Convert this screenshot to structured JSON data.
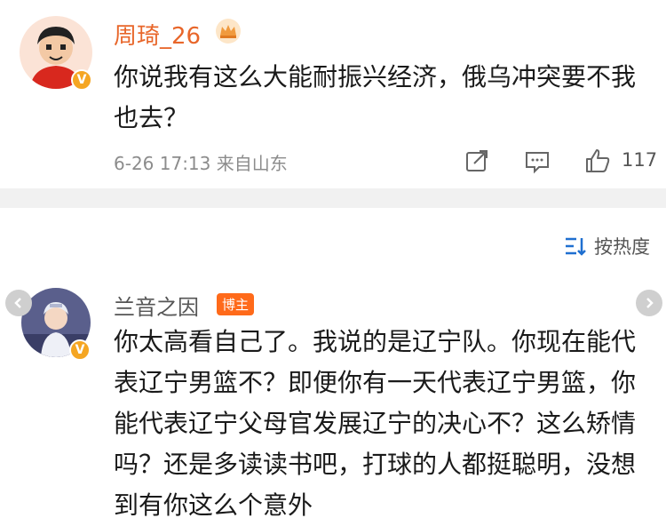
{
  "post": {
    "username": "周琦_26",
    "text": "你说我有这么大能耐振兴经济，俄乌冲突要不我也去？",
    "meta": "6-26 17:13 来自山东",
    "like_count": "117",
    "verified_badge": "V"
  },
  "sort": {
    "label": "按热度"
  },
  "comment": {
    "username": "兰音之因",
    "badge": "博主",
    "text": "你太高看自己了。我说的是辽宁队。你现在能代表辽宁男篮不？即便你有一天代表辽宁男篮，你能代表辽宁父母官发展辽宁的决心不？这么矫情吗？还是多读读书吧，打球的人都挺聪明，没想到有你这么个意外",
    "verified_badge": "V"
  },
  "colors": {
    "username_orange": "#e8662a",
    "badge_orange": "#ff6a1a",
    "verified_gold": "#f5a623",
    "divider": "#f1f1f1"
  },
  "icons": [
    "crown-icon",
    "share-icon",
    "comment-icon",
    "like-icon",
    "sort-icon",
    "left-arrow-icon",
    "right-arrow-icon"
  ]
}
